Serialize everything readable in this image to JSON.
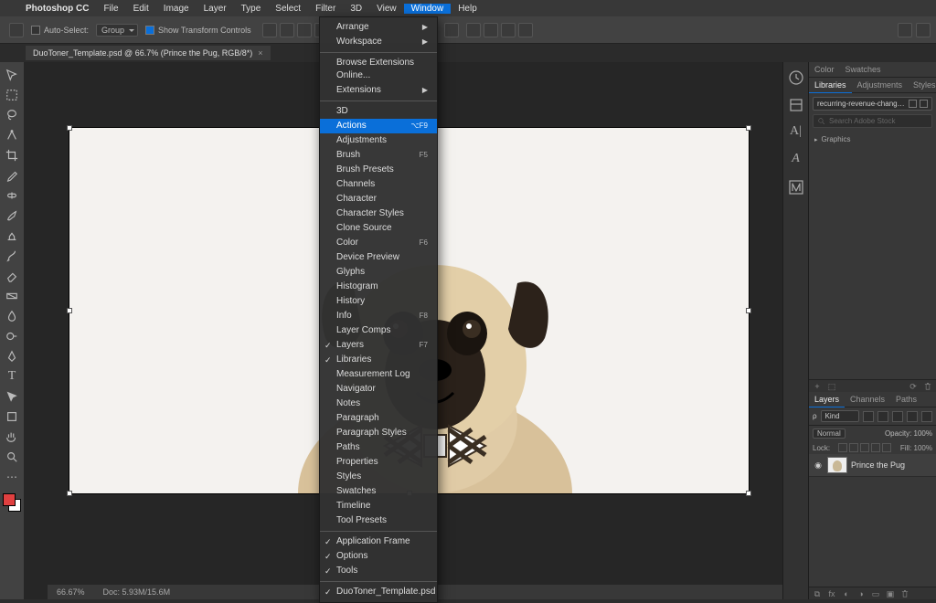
{
  "app": {
    "name": "Photoshop CC"
  },
  "menubar": [
    "File",
    "Edit",
    "Image",
    "Layer",
    "Type",
    "Select",
    "Filter",
    "3D",
    "View",
    "Window",
    "Help"
  ],
  "menubar_open": "Window",
  "options": {
    "auto_select": "Auto-Select:",
    "group": "Group",
    "show_transform": "Show Transform Controls"
  },
  "tab": {
    "title": "DuoToner_Template.psd @ 66.7% (Prince the Pug, RGB/8*)"
  },
  "dropdown": {
    "groups": [
      [
        {
          "label": "Arrange",
          "submenu": true
        },
        {
          "label": "Workspace",
          "submenu": true
        }
      ],
      [
        {
          "label": "Browse Extensions Online..."
        },
        {
          "label": "Extensions",
          "submenu": true
        }
      ],
      [
        {
          "label": "3D"
        },
        {
          "label": "Actions",
          "shortcut": "⌥F9",
          "highlight": true
        },
        {
          "label": "Adjustments"
        },
        {
          "label": "Brush",
          "shortcut": "F5"
        },
        {
          "label": "Brush Presets"
        },
        {
          "label": "Channels"
        },
        {
          "label": "Character"
        },
        {
          "label": "Character Styles"
        },
        {
          "label": "Clone Source"
        },
        {
          "label": "Color",
          "shortcut": "F6"
        },
        {
          "label": "Device Preview"
        },
        {
          "label": "Glyphs"
        },
        {
          "label": "Histogram"
        },
        {
          "label": "History"
        },
        {
          "label": "Info",
          "shortcut": "F8"
        },
        {
          "label": "Layer Comps"
        },
        {
          "label": "Layers",
          "shortcut": "F7",
          "checked": true
        },
        {
          "label": "Libraries",
          "checked": true
        },
        {
          "label": "Measurement Log"
        },
        {
          "label": "Navigator"
        },
        {
          "label": "Notes"
        },
        {
          "label": "Paragraph"
        },
        {
          "label": "Paragraph Styles"
        },
        {
          "label": "Paths"
        },
        {
          "label": "Properties"
        },
        {
          "label": "Styles"
        },
        {
          "label": "Swatches"
        },
        {
          "label": "Timeline"
        },
        {
          "label": "Tool Presets"
        }
      ],
      [
        {
          "label": "Application Frame",
          "checked": true
        },
        {
          "label": "Options",
          "checked": true
        },
        {
          "label": "Tools",
          "checked": true
        }
      ],
      [
        {
          "label": "DuoToner_Template.psd",
          "checked": true
        }
      ]
    ]
  },
  "panels": {
    "color_tabs": [
      "Color",
      "Swatches"
    ],
    "lib_tabs": [
      "Libraries",
      "Adjustments",
      "Styles"
    ],
    "lib_dd": "recurring-revenue-chang…",
    "lib_search_ph": "Search Adobe Stock",
    "lib_section": "Graphics"
  },
  "layers": {
    "tabs": [
      "Layers",
      "Channels",
      "Paths"
    ],
    "filter": "Kind",
    "blend": "Normal",
    "opacity_label": "Opacity:",
    "opacity": "100%",
    "lock_label": "Lock:",
    "fill_label": "Fill:",
    "fill": "100%",
    "items": [
      {
        "name": "Prince the Pug"
      }
    ]
  },
  "status": {
    "zoom": "66.67%",
    "doc": "Doc: 5.93M/15.6M"
  }
}
